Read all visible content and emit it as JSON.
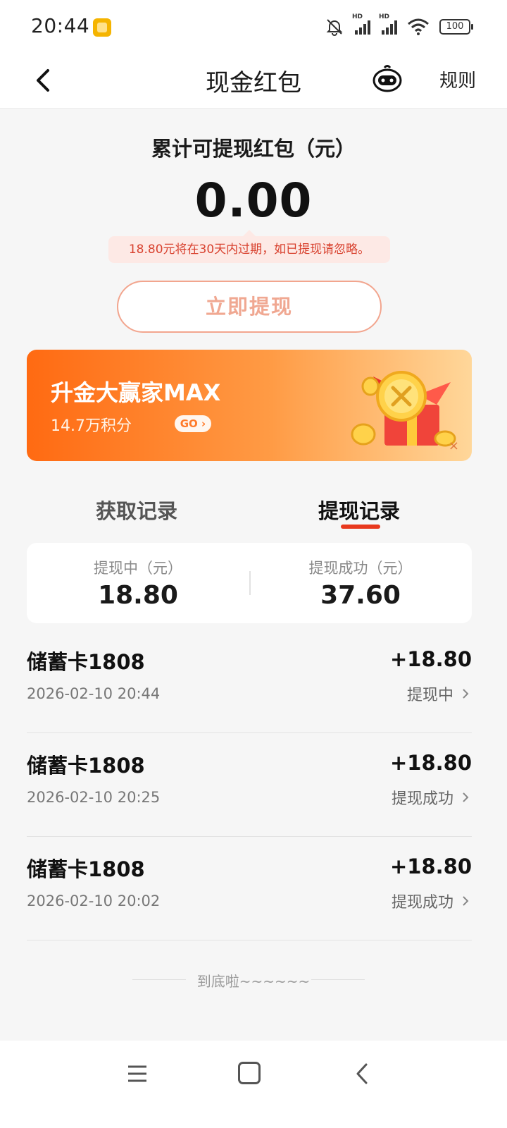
{
  "status_bar": {
    "time": "20:44",
    "battery": "100",
    "hd1": "HD",
    "hd2": "HD"
  },
  "nav": {
    "title": "现金红包",
    "rules": "规则"
  },
  "balance": {
    "label": "累计可提现红包（元）",
    "value": "0.00",
    "expire_notice": "18.80元将在30天内过期，如已提现请忽略。",
    "withdraw_button": "立即提现"
  },
  "banner": {
    "title": "升金大赢家MAX",
    "subtitle": "14.7万积分",
    "go_label": "GO",
    "close": "×"
  },
  "tabs": {
    "acquire": "获取记录",
    "withdraw": "提现记录",
    "active": "withdraw",
    "accent_color": "#e8391e"
  },
  "summary": {
    "pending_label": "提现中（元）",
    "pending_value": "18.80",
    "success_label": "提现成功（元）",
    "success_value": "37.60"
  },
  "records": [
    {
      "name": "储蓄卡1808",
      "date": "2026-02-10 20:44",
      "amount": "+18.80",
      "status": "提现中"
    },
    {
      "name": "储蓄卡1808",
      "date": "2026-02-10 20:25",
      "amount": "+18.80",
      "status": "提现成功"
    },
    {
      "name": "储蓄卡1808",
      "date": "2026-02-10 20:02",
      "amount": "+18.80",
      "status": "提现成功"
    }
  ],
  "footer_note": "到底啦~~~~~~",
  "icons": {
    "back": "back-arrow-icon",
    "assistant": "robot-assistant-icon",
    "chevron": "chevron-right-icon",
    "menu": "menu-icon",
    "home": "home-icon",
    "system_back": "system-back-icon"
  }
}
